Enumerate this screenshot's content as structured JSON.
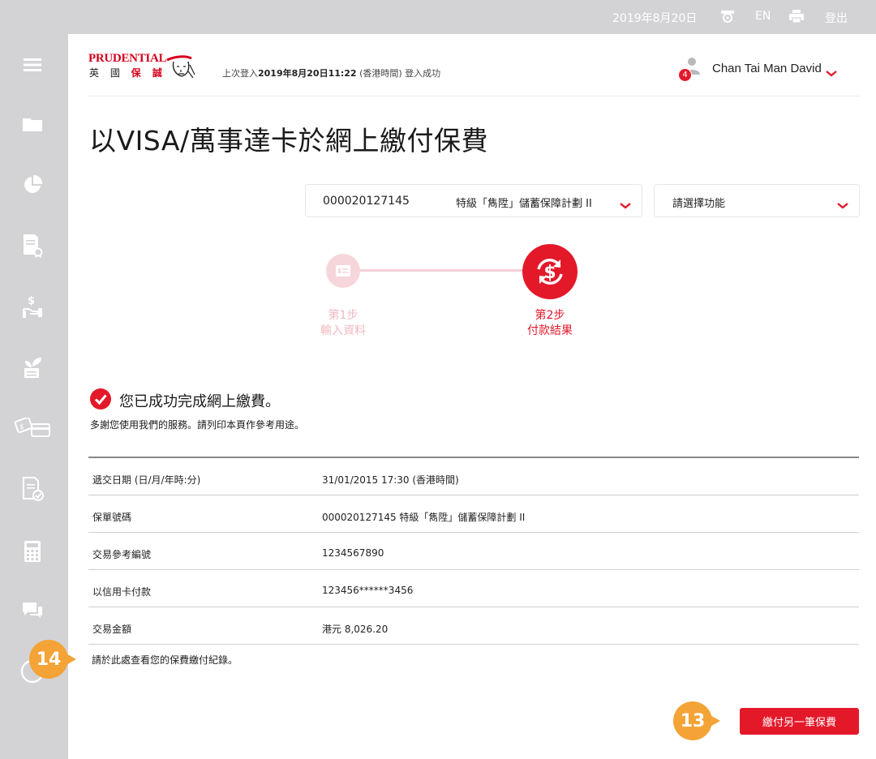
{
  "topbar": {
    "date": "2019年8月20日",
    "accessibility_icon": "accessibility-icon",
    "language": "EN",
    "print_icon": "print-icon",
    "logout": "登出"
  },
  "sidebar": {
    "items": [
      {
        "icon": "menu-icon"
      },
      {
        "icon": "folder-icon"
      },
      {
        "icon": "pie-chart-icon"
      },
      {
        "icon": "certificate-icon"
      },
      {
        "icon": "hand-dollar-icon"
      },
      {
        "icon": "plant-icon"
      },
      {
        "icon": "payment-card-icon"
      },
      {
        "icon": "document-check-icon"
      },
      {
        "icon": "calculator-icon"
      },
      {
        "icon": "chat-icon"
      },
      {
        "icon": "help-icon"
      }
    ]
  },
  "header": {
    "logo_brand": "PRUDENTIAL",
    "logo_cn_a": "英 國",
    "logo_cn_b": "保 誠",
    "last_login_prefix": "上次登入",
    "last_login_datetime": "2019年8月20日11:22",
    "last_login_suffix": "(香港時間) 登入成功",
    "notification_count": "4",
    "user_name": "Chan Tai Man David"
  },
  "page": {
    "title": "以VISA/萬事達卡於網上繳付保費"
  },
  "selectors": {
    "policy_number": "000020127145",
    "policy_name": "特級「雋陞」儲蓄保障計劃 II",
    "function_placeholder": "請選擇功能"
  },
  "stepper": {
    "step1_title": "第1步",
    "step1_label": "輸入資料",
    "step2_title": "第2步",
    "step2_label": "付款結果"
  },
  "result": {
    "success_message": "您已成功完成網上繳費。",
    "thanks_message": "多謝您使用我們的服務。請列印本頁作參考用途。",
    "rows": [
      {
        "key": "遞交日期 (日/月/年時:分)",
        "value": "31/01/2015 17:30 (香港時間)"
      },
      {
        "key": "保單號碼",
        "value": "000020127145 特級「雋陞」儲蓄保障計劃 II"
      },
      {
        "key": "交易參考編號",
        "value": "1234567890"
      },
      {
        "key": "以信用卡付款",
        "value": "123456******3456"
      },
      {
        "key": "交易金額",
        "value": "港元 8,026.20"
      }
    ],
    "history_link": "請於此處查看您的保費繳付紀錄。",
    "pay_another_button": "繳付另一筆保費"
  },
  "callouts": {
    "a": "14",
    "b": "13"
  },
  "colors": {
    "accent": "#e3192a",
    "callout": "#f4a336",
    "sidebar": "#d3d3d6"
  }
}
